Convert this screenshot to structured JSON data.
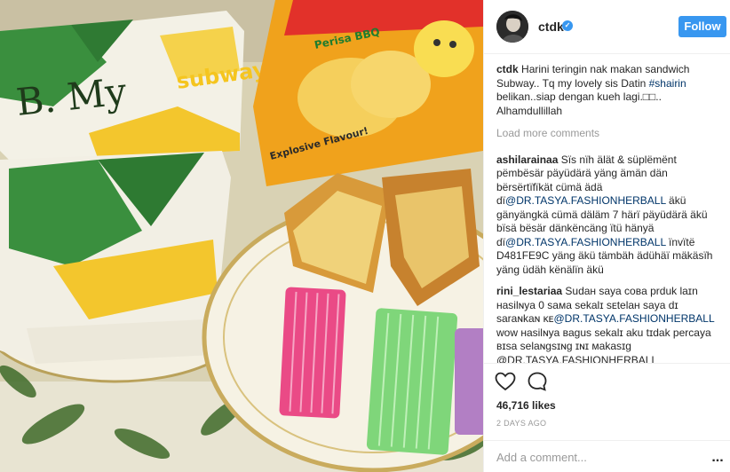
{
  "post": {
    "username": "ctdk",
    "follow_label": "Follow",
    "likes": "46,716 likes",
    "time_ago": "2 DAYS AGO",
    "add_comment_placeholder": "Add a comment...",
    "more_label": "..."
  },
  "photo": {
    "bag_label": "B. My",
    "bag_brand": "subway",
    "chips_text": "Perisa BBQ",
    "chips_badge": "Explosive Flavour!"
  },
  "caption": {
    "user": "ctdk",
    "text_before": "Harini teringin nak makan sandwich Subway.. Tq my lovely sis Datin ",
    "hashtag": "#shairin",
    "text_after": " belikan..siap dengan kueh lagi.□□.. Alhamdullillah"
  },
  "load_more": "Load more comments",
  "comments": [
    {
      "user": "ashilarainaa",
      "part1": "Sïs nïh älät & süplëmënt pëmbësär päyüdärä yäng ämän dän bërsërtïfïkät cümä ädä dï",
      "mention1": "@DR.TASYA.FASHIONHERBALL",
      "part2": " äkü gänyängkä cümä däläm 7 härï päyüdärä äkü bïsä bësär dänkëncäng ïtü hänyä dï",
      "mention2": "@DR.TASYA.FASHIONHERBALL",
      "part3": " ïnvïtë D481FE9C yäng äkü tämbäh ädühäï mäkäsïh yäng üdäh kënälïn äkü"
    },
    {
      "user": "rini_lestariaa",
      "part1": "Sudaʜ saya coʙa prduk laɪn ʜasilɴya 0 saᴍa sekalɪ sᴇtelaʜ saya dɪ saraɴkaɴ ᴋᴇ",
      "mention1": "@DR.TASYA.FASHIONHERBALL",
      "part2": " wow ʜasilɴya ʙagus sekalɪ aku tɪdak percaya ʙɪsa selaɴgsɪɴg ɪɴɪ ᴍakasɪg @DR.TASYA.FASHIONHERBALL"
    }
  ],
  "icons": [
    "heart-icon",
    "comment-icon",
    "verified-icon",
    "avatar"
  ],
  "colors": {
    "accent": "#3897f0",
    "mention": "#003569",
    "muted": "#999999"
  }
}
